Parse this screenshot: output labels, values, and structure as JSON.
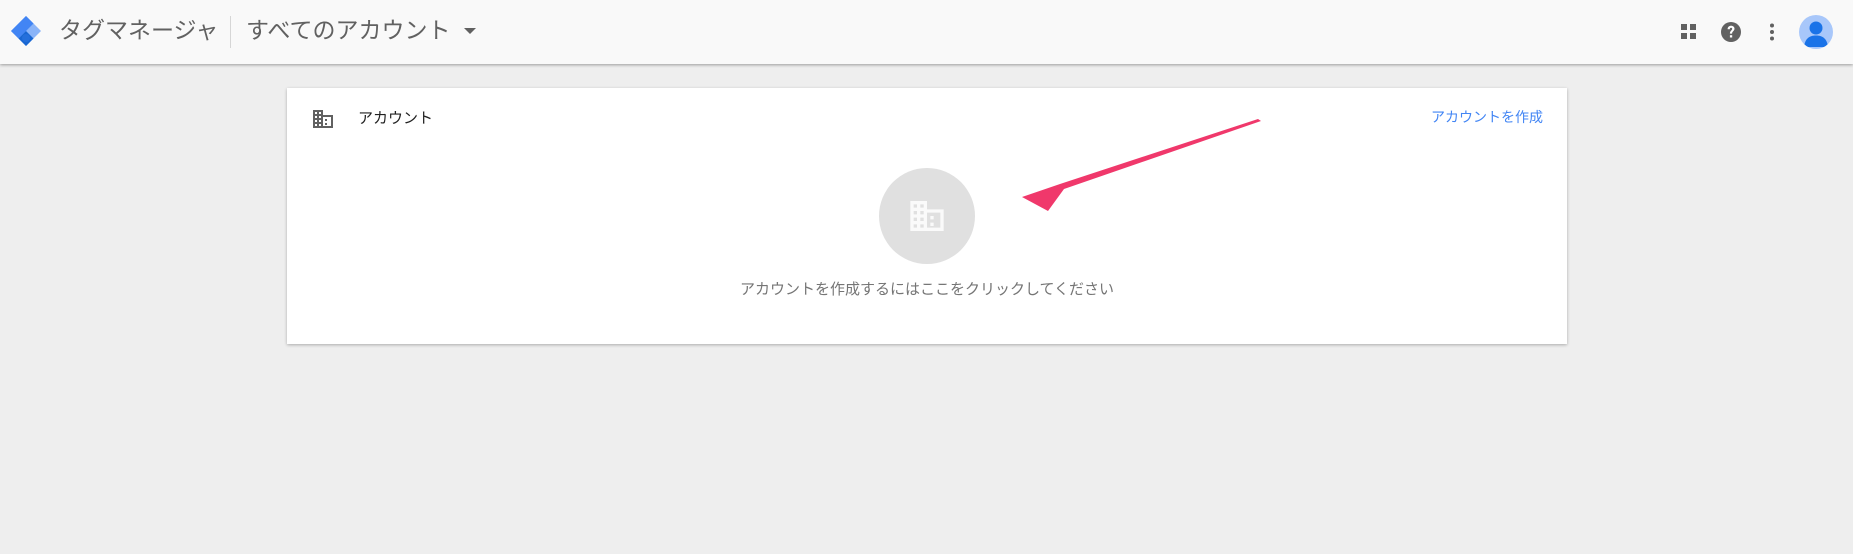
{
  "header": {
    "app_title": "タグマネージャ",
    "account_switcher": "すべてのアカウント",
    "icons": [
      "apps-icon",
      "help-icon",
      "more-vert-icon",
      "account-avatar-icon"
    ]
  },
  "card": {
    "title": "アカウント",
    "create_link": "アカウントを作成",
    "empty_message": "アカウントを作成するにはここをクリックしてください"
  },
  "colors": {
    "accent": "#4285f4",
    "annotation_arrow": "#f0386b",
    "background": "#eeeeee"
  }
}
